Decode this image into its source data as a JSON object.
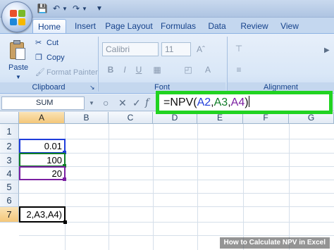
{
  "tabs": [
    "Home",
    "Insert",
    "Page Layout",
    "Formulas",
    "Data",
    "Review",
    "View"
  ],
  "clipboard": {
    "paste": "Paste",
    "cut": "Cut",
    "copy": "Copy",
    "format_painter": "Format Painter",
    "label": "Clipboard"
  },
  "font": {
    "name": "Calibri",
    "size": "11",
    "label": "Font"
  },
  "alignment": {
    "label": "Alignment"
  },
  "formula_bar": {
    "name_box": "SUM",
    "formula_prefix": "=NPV(",
    "ref_a2": "A2",
    "sep1": ",",
    "ref_a3": "A3",
    "sep2": ",",
    "ref_a4": "A4",
    "formula_suffix": ")"
  },
  "columns": [
    "A",
    "B",
    "C",
    "D",
    "E",
    "F",
    "G"
  ],
  "rows": [
    "1",
    "2",
    "3",
    "4",
    "5",
    "6",
    "7"
  ],
  "cells": {
    "A2": "0.01",
    "A3": "100",
    "A4": "20",
    "A7": "2,A3,A4)"
  },
  "watermark": "How to Calculate NPV in Excel",
  "colors": {
    "highlight": "#21d321",
    "ref_a2": "#1f3ddb",
    "ref_a3": "#0f7d27",
    "ref_a4": "#7b1fa2",
    "selected_header": "#f4c77a"
  }
}
